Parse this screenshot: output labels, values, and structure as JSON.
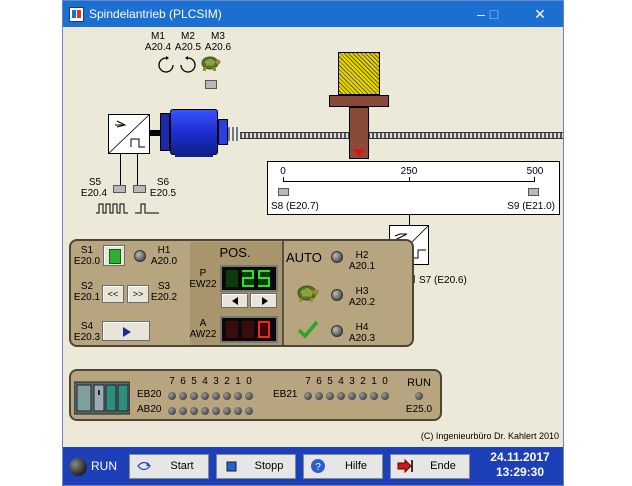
{
  "window": {
    "title": "Spindelantrieb (PLCSIM)",
    "minimize": "–",
    "maximize": "□",
    "close": "✕"
  },
  "motors": {
    "m1": {
      "name": "M1",
      "addr": "A20.4"
    },
    "m2": {
      "name": "M2",
      "addr": "A20.5"
    },
    "m3": {
      "name": "M3",
      "addr": "A20.6"
    }
  },
  "sensors": {
    "s5": {
      "name": "S5",
      "addr": "E20.4"
    },
    "s6": {
      "name": "S6",
      "addr": "E20.5"
    },
    "s7": "S7 (E20.6)",
    "s8": "S8 (E20.7)",
    "s9": "S9 (E21.0)"
  },
  "scale": {
    "min": "0",
    "mid": "250",
    "max": "500"
  },
  "control": {
    "s1": {
      "name": "S1",
      "addr": "E20.0"
    },
    "s2": {
      "name": "S2",
      "addr": "E20.1"
    },
    "s3": {
      "name": "S3",
      "addr": "E20.2"
    },
    "s4": {
      "name": "S4",
      "addr": "E20.3"
    },
    "h1": {
      "name": "H1",
      "addr": "A20.0"
    },
    "h2": {
      "name": "H2",
      "addr": "A20.1"
    },
    "h3": {
      "name": "H3",
      "addr": "A20.2"
    },
    "h4": {
      "name": "H4",
      "addr": "A20.3"
    },
    "back_label": "<<",
    "fwd_label": ">>",
    "pos_title": "POS.",
    "p_label": "P",
    "p_addr": "EW22",
    "a_label": "A",
    "a_addr": "AW22",
    "auto_label": "AUTO"
  },
  "io": {
    "bits": [
      "7",
      "6",
      "5",
      "4",
      "3",
      "2",
      "1",
      "0"
    ],
    "eb20": "EB20",
    "ab20": "AB20",
    "eb21": "EB21",
    "run": "RUN",
    "e25": "E25.0"
  },
  "copyright": "(C) Ingenieurbüro Dr. Kahlert 2010",
  "bottom": {
    "run": "RUN",
    "start": "Start",
    "stop": "Stopp",
    "help": "Hilfe",
    "end": "Ende",
    "date": "24.11.2017",
    "time": "13:29:30"
  },
  "colors": {
    "titlebar": "#1a6fd1",
    "bottombar": "#1d3fb8",
    "panel": "#b6a57f",
    "motor": "#2a3fe0",
    "carriage": "#8a4a3a"
  }
}
